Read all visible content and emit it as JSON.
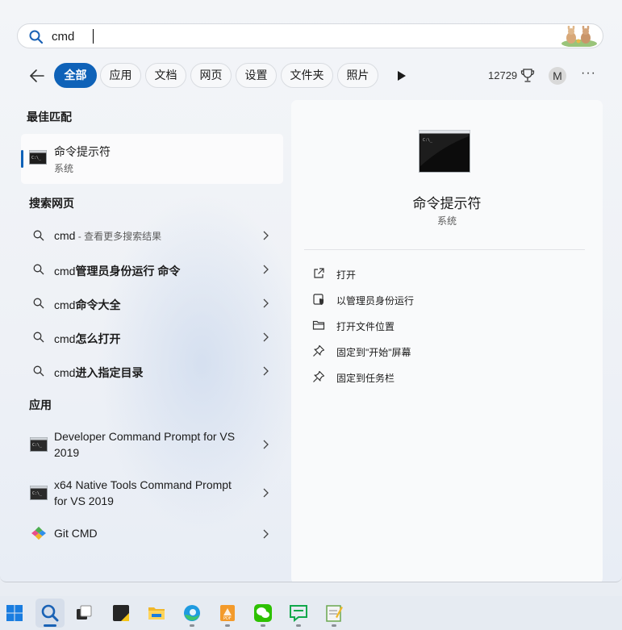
{
  "search": {
    "value": "cmd",
    "placeholder": ""
  },
  "filters": {
    "tabs": [
      {
        "label": "全部",
        "active": true
      },
      {
        "label": "应用"
      },
      {
        "label": "文档"
      },
      {
        "label": "网页"
      },
      {
        "label": "设置"
      },
      {
        "label": "文件夹"
      },
      {
        "label": "照片"
      }
    ],
    "points": "12729",
    "avatar_initial": "M",
    "more": "···"
  },
  "best_match": {
    "section_title": "最佳匹配",
    "name": "命令提示符",
    "type": "系统"
  },
  "web_search": {
    "section_title": "搜索网页",
    "items": [
      {
        "query": "cmd",
        "suffix": " - 查看更多搜索结果",
        "bold_part": ""
      },
      {
        "query": "cmd",
        "suffix": "",
        "bold_part": "管理员身份运行 命令"
      },
      {
        "query": "cmd",
        "suffix": "",
        "bold_part": "命令大全"
      },
      {
        "query": "cmd",
        "suffix": "",
        "bold_part": "怎么打开"
      },
      {
        "query": "cmd",
        "suffix": "",
        "bold_part": "进入指定目录"
      }
    ]
  },
  "apps": {
    "section_title": "应用",
    "items": [
      {
        "name": "Developer Command Prompt for VS 2019"
      },
      {
        "name": "x64 Native Tools Command Prompt for VS 2019"
      },
      {
        "name": "Git CMD"
      }
    ]
  },
  "detail": {
    "title": "命令提示符",
    "subtitle": "系统",
    "actions": [
      {
        "label": "打开",
        "icon": "open-external-icon"
      },
      {
        "label": "以管理员身份运行",
        "icon": "shield-icon"
      },
      {
        "label": "打开文件位置",
        "icon": "folder-icon"
      },
      {
        "label": "固定到\"开始\"屏幕",
        "icon": "pin-icon"
      },
      {
        "label": "固定到任务栏",
        "icon": "pin-icon"
      }
    ]
  },
  "taskbar": {
    "items": [
      "windows-start-icon",
      "search-icon",
      "task-view-icon",
      "notes-icon",
      "file-explorer-icon",
      "edge-icon",
      "pdf-icon",
      "wechat-icon",
      "chat-icon",
      "notepad-icon"
    ]
  },
  "colors": {
    "accent": "#0f62b8",
    "panel_bg": "#f3f5f8",
    "detail_bg": "#f9fafb"
  }
}
